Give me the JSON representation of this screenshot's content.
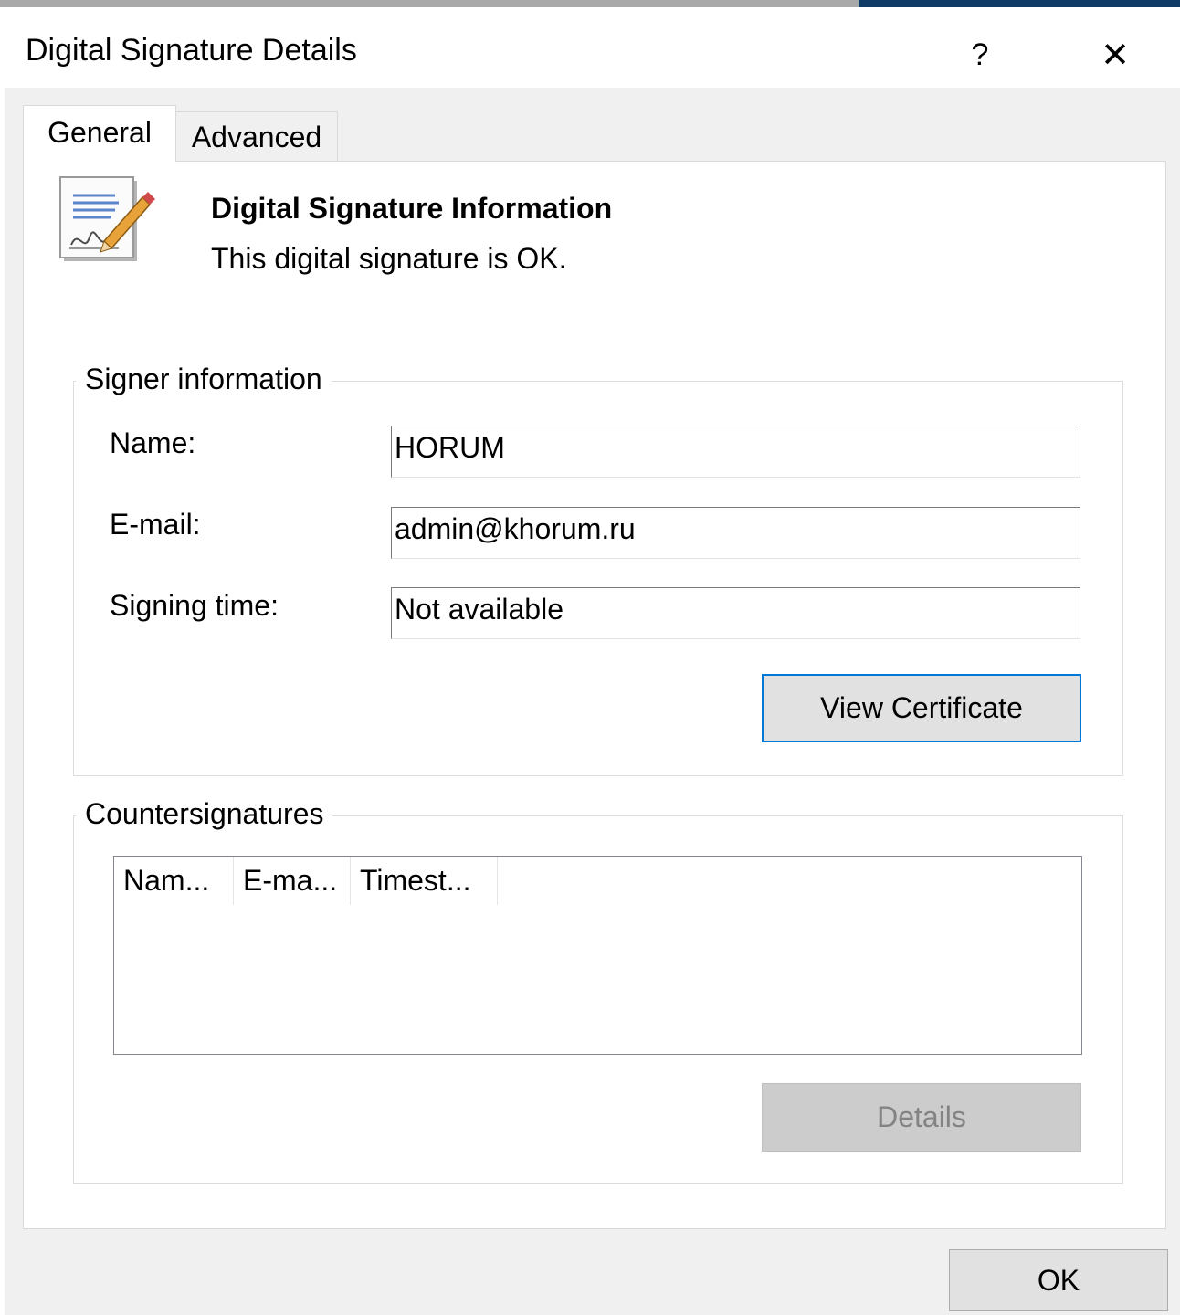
{
  "window": {
    "title": "Digital Signature Details",
    "help_glyph": "?",
    "close_glyph": "✕"
  },
  "tabs": [
    {
      "label": "General",
      "selected": true
    },
    {
      "label": "Advanced",
      "selected": false
    }
  ],
  "info": {
    "icon": "signature-document-icon",
    "title": "Digital Signature Information",
    "status": "This digital signature is OK."
  },
  "signer": {
    "legend": "Signer information",
    "name_label": "Name:",
    "name_value": "HORUM",
    "email_label": "E-mail:",
    "email_value": "admin@khorum.ru",
    "time_label": "Signing time:",
    "time_value": "Not available",
    "view_certificate_label": "View Certificate"
  },
  "countersignatures": {
    "legend": "Countersignatures",
    "columns": [
      "Nam...",
      "E-ma...",
      "Timest..."
    ],
    "rows": [],
    "details_label": "Details"
  },
  "footer": {
    "ok_label": "OK"
  },
  "colors": {
    "focus_border": "#0078d7",
    "dialog_background": "#f0f0f0",
    "disabled_text": "#838383"
  }
}
